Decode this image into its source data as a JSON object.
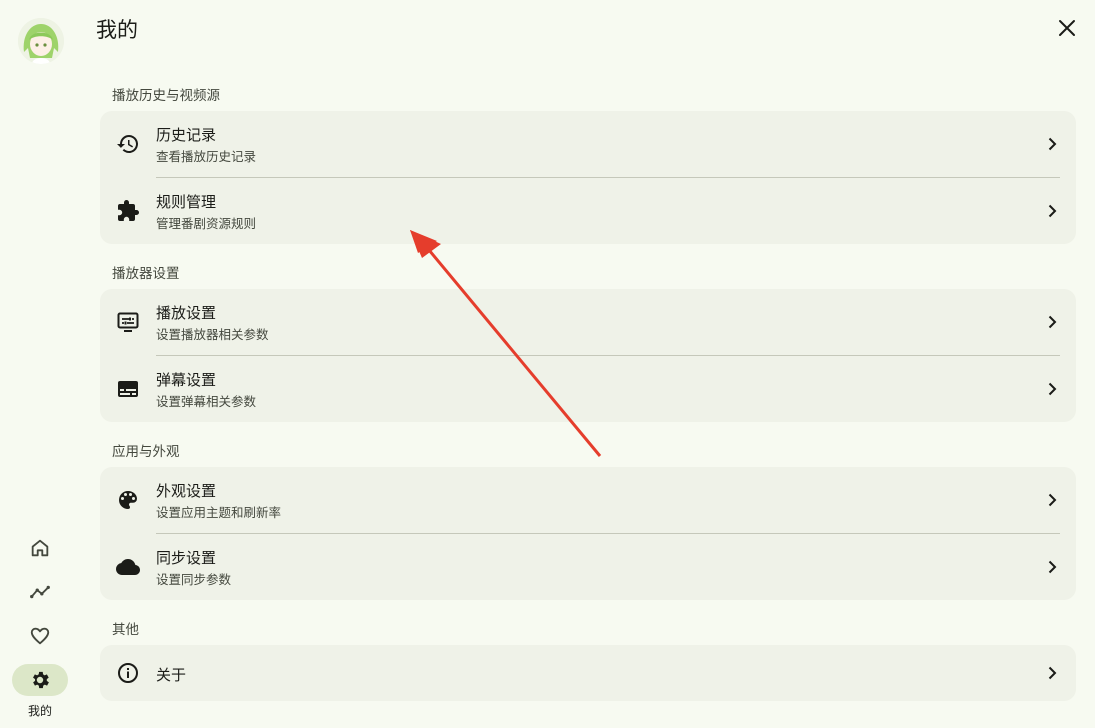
{
  "header": {
    "title": "我的"
  },
  "nav": {
    "active_label": "我的"
  },
  "sections": [
    {
      "title": "播放历史与视频源",
      "items": [
        {
          "title": "历史记录",
          "subtitle": "查看播放历史记录",
          "icon": "history-icon"
        },
        {
          "title": "规则管理",
          "subtitle": "管理番剧资源规则",
          "icon": "extension-icon"
        }
      ]
    },
    {
      "title": "播放器设置",
      "items": [
        {
          "title": "播放设置",
          "subtitle": "设置播放器相关参数",
          "icon": "player-settings-icon"
        },
        {
          "title": "弹幕设置",
          "subtitle": "设置弹幕相关参数",
          "icon": "subtitles-icon"
        }
      ]
    },
    {
      "title": "应用与外观",
      "items": [
        {
          "title": "外观设置",
          "subtitle": "设置应用主题和刷新率",
          "icon": "palette-icon"
        },
        {
          "title": "同步设置",
          "subtitle": "设置同步参数",
          "icon": "cloud-icon"
        }
      ]
    },
    {
      "title": "其他",
      "items": [
        {
          "title": "关于",
          "icon": "info-icon"
        }
      ]
    }
  ],
  "colors": {
    "background": "#f7faf1",
    "card": "#eff2e8",
    "active_nav": "#dce7c8",
    "annotation_arrow": "#e53d2c"
  }
}
